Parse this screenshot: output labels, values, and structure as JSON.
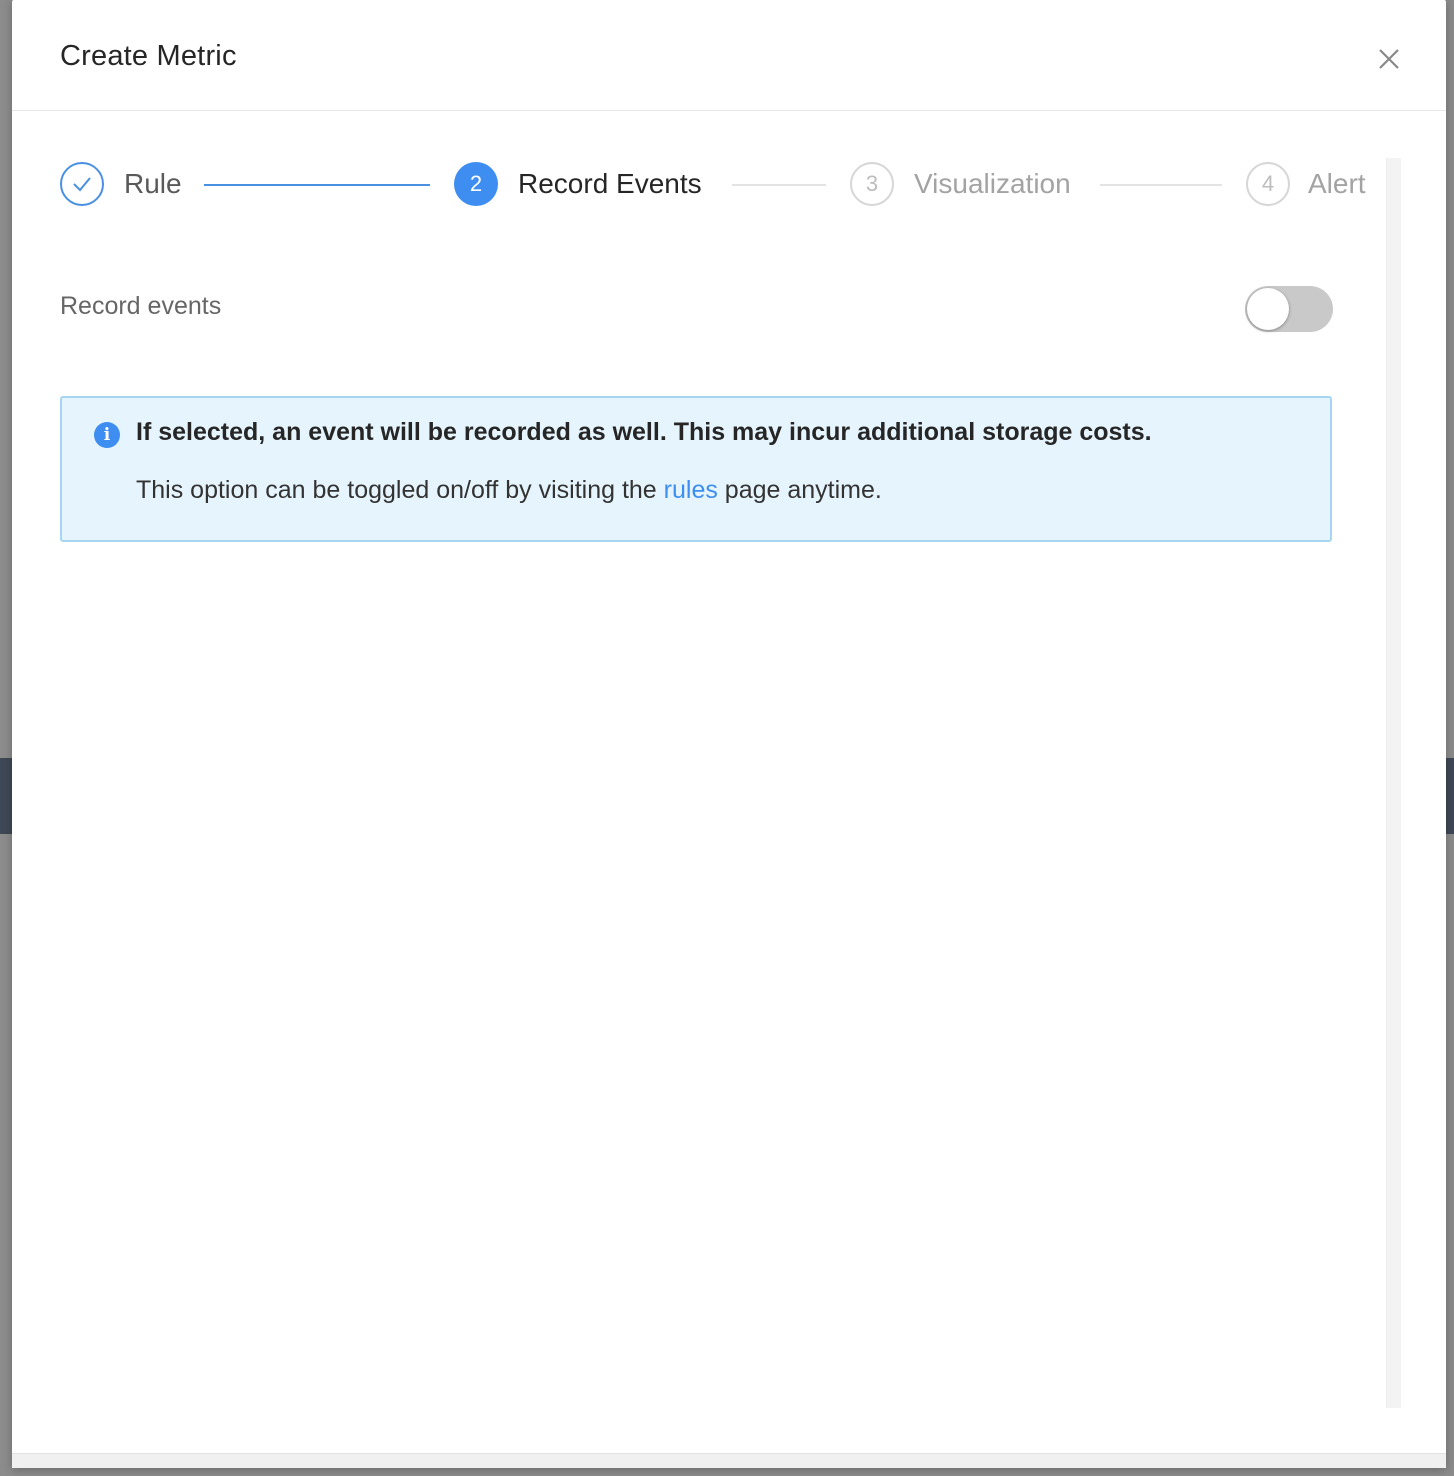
{
  "modal": {
    "title": "Create Metric"
  },
  "steps": [
    {
      "number": "1",
      "label": "Rule",
      "status": "done"
    },
    {
      "number": "2",
      "label": "Record Events",
      "status": "active"
    },
    {
      "number": "3",
      "label": "Visualization",
      "status": "pending"
    },
    {
      "number": "4",
      "label": "Alert",
      "status": "pending"
    }
  ],
  "record_events": {
    "label": "Record events",
    "toggle_on": false
  },
  "info_alert": {
    "title": "If selected, an event will be recorded as well. This may incur additional storage costs.",
    "body_before": "This option can be toggled on/off by visiting the ",
    "link_text": "rules",
    "body_after": " page anytime."
  },
  "colors": {
    "accent": "#3d8ef0",
    "alert_bg": "#e6f5fd",
    "alert_border": "#a6d6f2",
    "toggle_off": "#c9c9c9"
  }
}
